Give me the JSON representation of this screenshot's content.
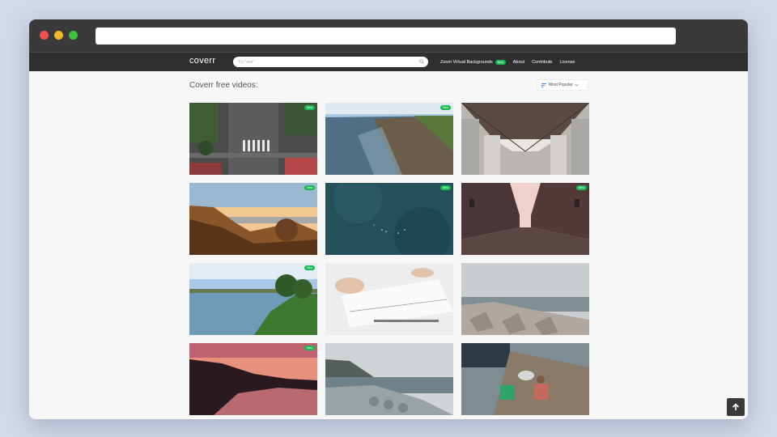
{
  "browser": {
    "traffic_lights": [
      "#f0524f",
      "#f5b727",
      "#3cc13b"
    ],
    "url": ""
  },
  "navbar": {
    "logo": "coverr",
    "search_placeholder": "Try \"sea\"",
    "links": [
      {
        "label": "Zoom Virtual Backgrounds",
        "badge": "New"
      },
      {
        "label": "About"
      },
      {
        "label": "Contribute"
      },
      {
        "label": "License"
      }
    ]
  },
  "main": {
    "heading": "Coverr free videos:",
    "sort_label": "Most Popular",
    "new_badge": "New",
    "videos": [
      {
        "scene": "aerial-crosswalk",
        "is_new": true
      },
      {
        "scene": "beach-shore",
        "is_new": true
      },
      {
        "scene": "bridge-underside",
        "is_new": false
      },
      {
        "scene": "coastal-sunset-hills",
        "is_new": true
      },
      {
        "scene": "deep-sea-water",
        "is_new": true
      },
      {
        "scene": "empty-street",
        "is_new": true
      },
      {
        "scene": "lake-shore-town",
        "is_new": true
      },
      {
        "scene": "desk-writing",
        "is_new": false
      },
      {
        "scene": "breakwater-stones",
        "is_new": false
      },
      {
        "scene": "pink-sunset-lake",
        "is_new": true
      },
      {
        "scene": "coastline-breakwater",
        "is_new": false
      },
      {
        "scene": "fisherman-dock",
        "is_new": false
      }
    ]
  },
  "colors": {
    "accent": "#1db954",
    "nav_bg": "#2f2f2f"
  }
}
